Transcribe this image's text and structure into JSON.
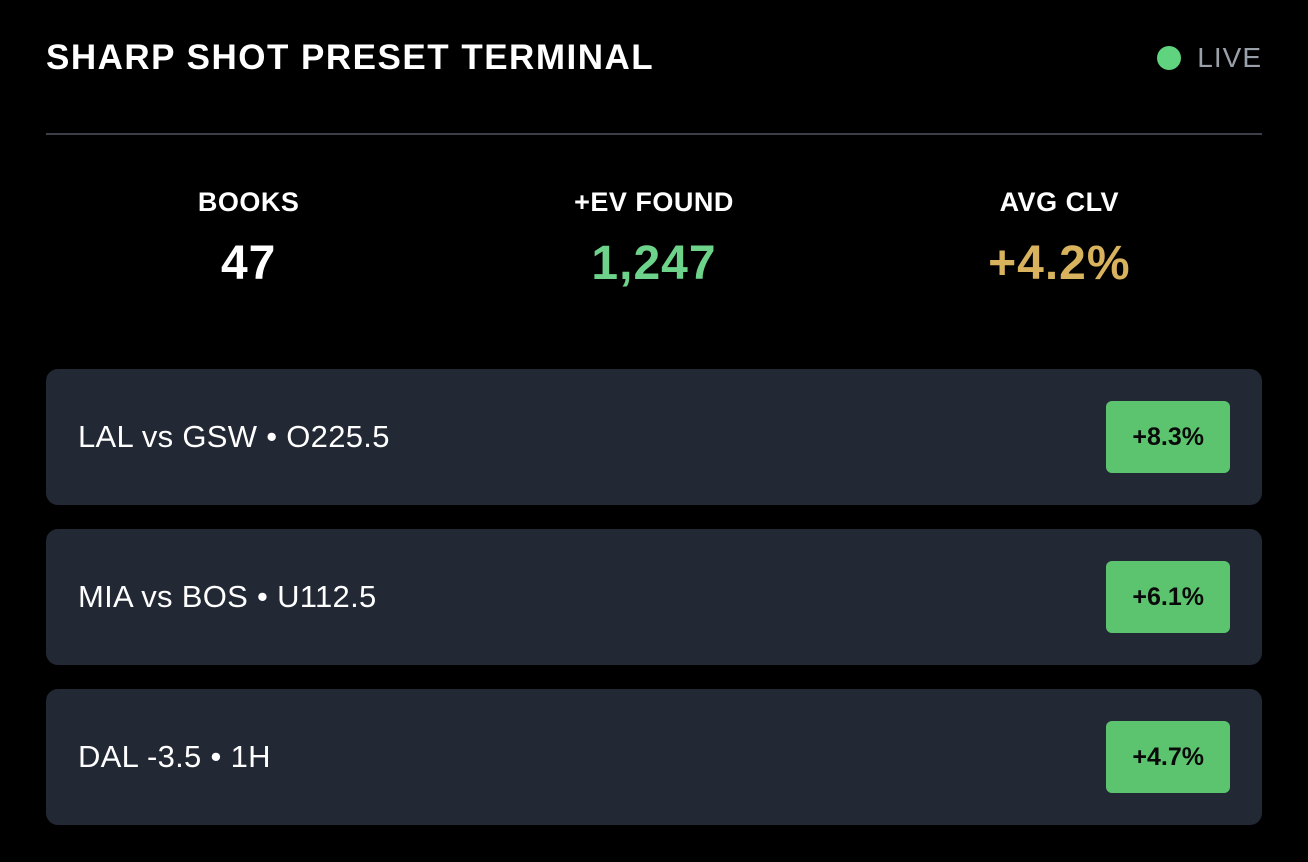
{
  "header": {
    "title": "SHARP SHOT PRESET TERMINAL",
    "status_label": "LIVE",
    "status_color": "#5fd37e"
  },
  "stats": [
    {
      "label": "BOOKS",
      "value": "47",
      "color": "#ffffff"
    },
    {
      "label": "+EV FOUND",
      "value": "1,247",
      "color": "#6ed38a"
    },
    {
      "label": "AVG CLV",
      "value": "+4.2%",
      "color": "#d9b25e"
    }
  ],
  "opportunities": [
    {
      "label": "LAL vs GSW • O225.5",
      "edge": "+8.3%"
    },
    {
      "label": "MIA vs BOS • U112.5",
      "edge": "+6.1%"
    },
    {
      "label": "DAL -3.5 • 1H",
      "edge": "+4.7%"
    }
  ]
}
